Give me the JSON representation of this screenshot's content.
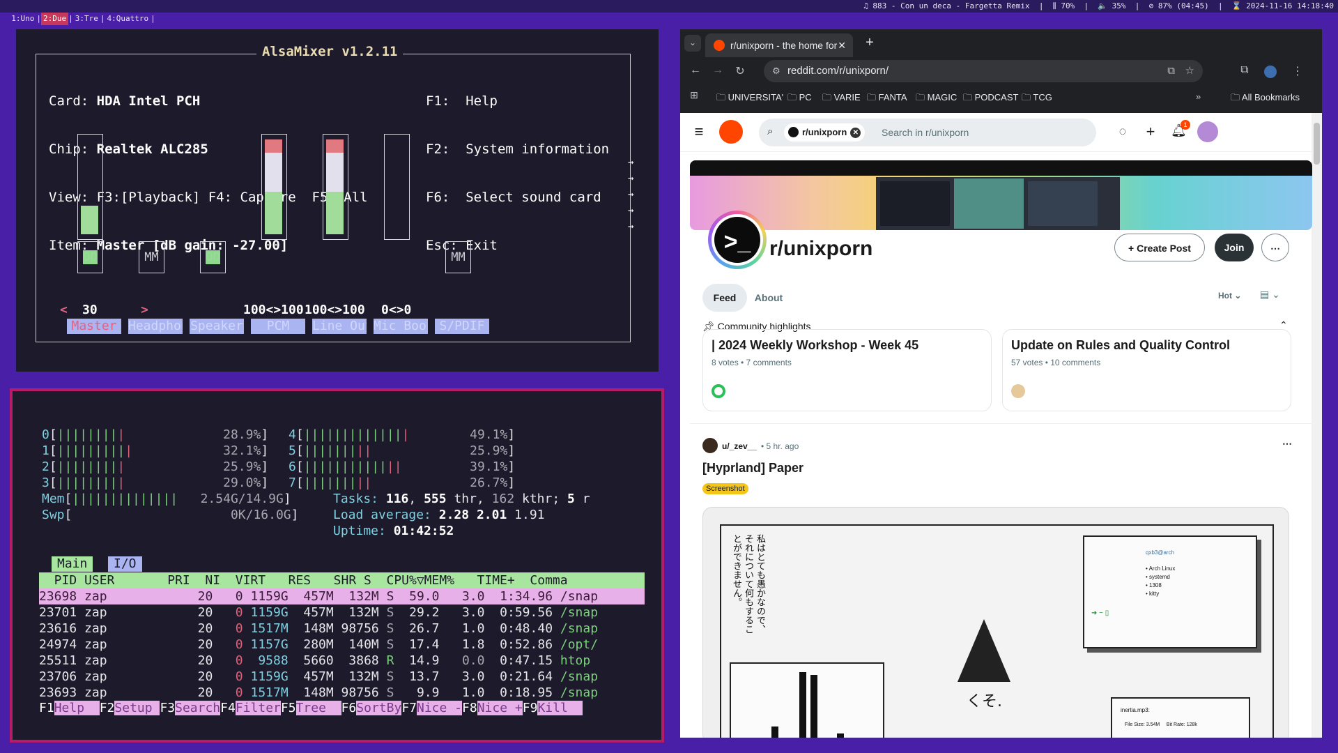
{
  "topbar": {
    "workspaces": [
      "1:Uno",
      "2:Due",
      "3:Tre",
      "4:Quattro"
    ],
    "active_workspace": 1,
    "status": "♫ 883 - Con un deca - Fargetta Remix  |  ⫼ 70%  |  🔈 35%  |  ⊘ 87% (04:45)  |  ⌛ 2024-11-16 14:18:40"
  },
  "alsamixer": {
    "title": "AlsaMixer v1.2.11",
    "card_label": "Card:",
    "card_value": "HDA Intel PCH",
    "chip_label": "Chip:",
    "chip_value": "Realtek ALC285",
    "view_label": "View:",
    "view_value": "F3:[Playback] F4: Capture  F5: All",
    "item_label": "Item:",
    "item_value": "Master [dB gain: -27.00]",
    "help": [
      "F1:  Help",
      "F2:  System information",
      "F6:  Select sound card",
      "Esc: Exit"
    ],
    "channels": [
      {
        "name": "Master",
        "volume_text": "30",
        "level": 0.3,
        "mute": "OO",
        "has_gauge": true,
        "selected": true
      },
      {
        "name": "Headphon",
        "volume_text": "",
        "level": 0,
        "mute": "MM",
        "has_gauge": false,
        "selected": false
      },
      {
        "name": "Speaker",
        "volume_text": "",
        "level": 0,
        "mute": "OO",
        "has_gauge": false,
        "selected": false
      },
      {
        "name": "PCM",
        "volume_text": "100<>100",
        "level": 1.0,
        "mute": "",
        "has_gauge": true,
        "selected": false
      },
      {
        "name": "Line Out",
        "volume_text": "100<>100",
        "level": 1.0,
        "mute": "",
        "has_gauge": true,
        "selected": false
      },
      {
        "name": "Mic Boos",
        "volume_text": "0<>0",
        "level": 0,
        "mute": "",
        "has_gauge": true,
        "selected": false
      },
      {
        "name": "S/PDIF",
        "volume_text": "",
        "level": 0,
        "mute": "MM",
        "has_gauge": false,
        "selected": false
      }
    ],
    "arrows": [
      "→",
      "→",
      "→",
      "→",
      "→"
    ]
  },
  "htop": {
    "cpus": [
      {
        "id": "0",
        "bars": "||||||||",
        "red": "|",
        "pct": "28.9%"
      },
      {
        "id": "1",
        "bars": "|||||||||",
        "red": "|",
        "pct": "32.1%"
      },
      {
        "id": "2",
        "bars": "||||||||",
        "red": "|",
        "pct": "25.9%"
      },
      {
        "id": "3",
        "bars": "||||||||",
        "red": "|",
        "pct": "29.0%"
      },
      {
        "id": "4",
        "bars": "|||||||||||||",
        "red": "|",
        "pct": "49.1%"
      },
      {
        "id": "5",
        "bars": "|||||||",
        "red": "||",
        "pct": "25.9%"
      },
      {
        "id": "6",
        "bars": "|||||||||||",
        "red": "||",
        "pct": "39.1%"
      },
      {
        "id": "7",
        "bars": "|||||||",
        "red": "||",
        "pct": "26.7%"
      }
    ],
    "mem_label": "Mem",
    "mem_bars": "||||||||||||||",
    "mem_value": "2.54G/14.9G",
    "swp_label": "Swp",
    "swp_value": "0K/16.0G",
    "tasks_label": "Tasks:",
    "tasks": "116",
    "thr": "555",
    "thr_label": "thr,",
    "kthr": "162",
    "kthr_label": "kthr;",
    "running": "5",
    "running_label": "r",
    "load_label": "Load average:",
    "load1": "2.28",
    "load5": "2.01",
    "load15": "1.91",
    "uptime_label": "Uptime:",
    "uptime": "01:42:52",
    "tabs": [
      "Main",
      "I/O"
    ],
    "header": "  PID USER       PRI  NI  VIRT   RES   SHR S  CPU%▽MEM%   TIME+  Comma",
    "processes": [
      [
        "23698",
        "zap",
        "20",
        "0",
        "1159G",
        "457M",
        "132M",
        "S",
        "59.0",
        "3.0",
        "1:34.96",
        "/snap"
      ],
      [
        "23701",
        "zap",
        "20",
        "0",
        "1159G",
        "457M",
        "132M",
        "S",
        "29.2",
        "3.0",
        "0:59.56",
        "/snap"
      ],
      [
        "23616",
        "zap",
        "20",
        "0",
        "1517M",
        "148M",
        "98756",
        "S",
        "26.7",
        "1.0",
        "0:48.40",
        "/snap"
      ],
      [
        "24974",
        "zap",
        "20",
        "0",
        "1157G",
        "280M",
        "140M",
        "S",
        "17.4",
        "1.8",
        "0:52.86",
        "/opt/"
      ],
      [
        "25511",
        "zap",
        "20",
        "0",
        "9588",
        "5660",
        "3868",
        "R",
        "14.9",
        "0.0",
        "0:47.15",
        "htop"
      ],
      [
        "23706",
        "zap",
        "20",
        "0",
        "1159G",
        "457M",
        "132M",
        "S",
        "13.7",
        "3.0",
        "0:21.64",
        "/snap"
      ],
      [
        "23693",
        "zap",
        "20",
        "0",
        "1517M",
        "148M",
        "98756",
        "S",
        "9.9",
        "1.0",
        "0:18.95",
        "/snap"
      ]
    ],
    "fkeys": [
      [
        "F1",
        "Help  "
      ],
      [
        "F2",
        "Setup "
      ],
      [
        "F3",
        "Search"
      ],
      [
        "F4",
        "Filter"
      ],
      [
        "F5",
        "Tree  "
      ],
      [
        "F6",
        "SortBy"
      ],
      [
        "F7",
        "Nice -"
      ],
      [
        "F8",
        "Nice +"
      ],
      [
        "F9",
        "Kill  "
      ]
    ]
  },
  "browser": {
    "tab_title": "r/unixporn - the home for",
    "url": "reddit.com/r/unixporn/",
    "bookmarks": [
      "UNIVERSITA'",
      "PC",
      "VARIE",
      "FANTA",
      "MAGIC",
      "PODCAST",
      "TCG"
    ],
    "all_bookmarks": "All Bookmarks",
    "search_chip": "r/unixporn",
    "search_placeholder": "Search in r/unixporn",
    "notif_count": "1",
    "subreddit": "r/unixporn",
    "create_post": "Create Post",
    "join": "Join",
    "feed_tab": "Feed",
    "about_tab": "About",
    "sort": "Hot",
    "highlights_label": "Community highlights",
    "highlights": [
      {
        "title": "| 2024 Weekly Workshop - Week 45",
        "meta": "8 votes • 7 comments"
      },
      {
        "title": "Update on Rules and Quality Control",
        "meta": "57 votes • 10 comments"
      }
    ],
    "post_user": "u/_zev__",
    "post_time": "• 5 hr. ago",
    "post_title": "[Hyprland] Paper",
    "post_flair": "Screenshot",
    "post_img_text": "私はとても愚かなので、それについて何もすることができません。",
    "post_img_kuso": "くそ.",
    "post_img_user": "qxb3@arch",
    "post_img_list": [
      "• Arch Linux",
      "• systemd",
      "• 1308",
      "• kitty"
    ],
    "post_img_file": "inertia.mp3:",
    "post_img_file2": "File Size: 3.54M     Bit Rate: 128k",
    "colors": {
      "accent": "#ff4500",
      "join": "#2a3236",
      "flair": "#f5c518"
    }
  }
}
